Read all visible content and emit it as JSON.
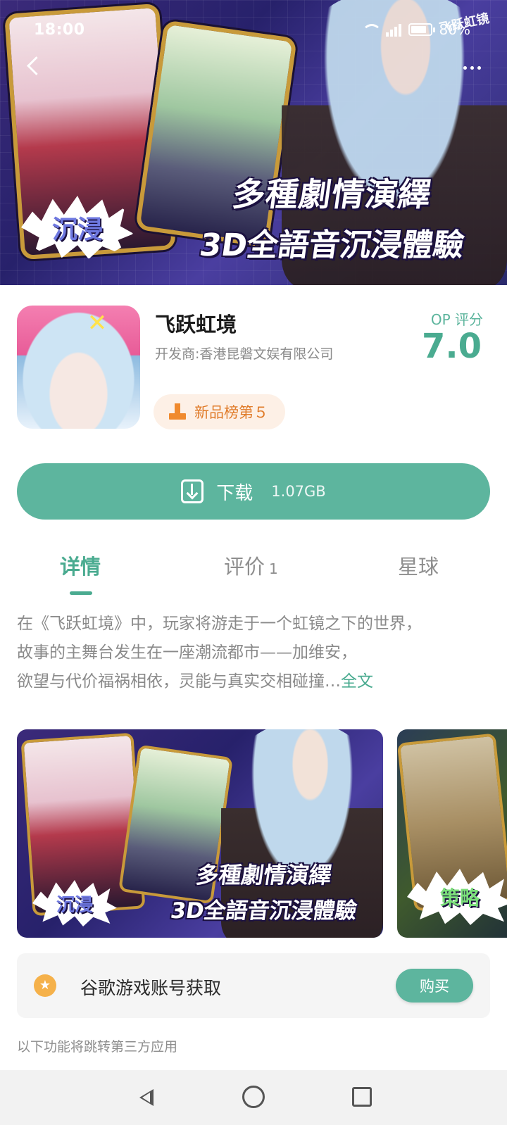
{
  "status_bar": {
    "time": "18:00",
    "network": "4G",
    "battery_percent": "80%",
    "battery_level": 0.8
  },
  "hero": {
    "slogan_line1": "多種劇情演繹",
    "slogan_line2": "3D全語音沉浸體驗",
    "burst_text": "沉浸",
    "logo_text": "飞跃虹镜"
  },
  "app": {
    "name": "飞跃虹境",
    "developer": "开发商:香港昆磐文娱有限公司",
    "rank_badge": "新品榜第５",
    "score_label": "OP 评分",
    "score_value": "7.0"
  },
  "download": {
    "label": "下载",
    "size": "1.07GB"
  },
  "tabs": [
    {
      "label": "详情",
      "active": true
    },
    {
      "label": "评价",
      "count": "1",
      "active": false
    },
    {
      "label": "星球",
      "active": false
    }
  ],
  "description": {
    "line1": "在《飞跃虹境》中，玩家将游走于一个虹镜之下的世界，",
    "line2": "故事的主舞台发生在一座潮流都市——加维安，",
    "line3": "欲望与代价福祸相依，灵能与真实交相碰撞…",
    "more_link": "全文"
  },
  "screenshots": [
    {
      "slogan_line1": "多種劇情演繹",
      "slogan_line2": "3D全語音沉浸體驗",
      "burst_text": "沉浸"
    },
    {
      "burst_text": "策略"
    }
  ],
  "service": {
    "label": "谷歌游戏账号获取",
    "button": "购买"
  },
  "footer_note": "以下功能将跳转第三方应用",
  "icons": {
    "back": "chevron-left-icon",
    "more": "more-dots-icon",
    "rank": "podium-icon",
    "download": "download-icon",
    "service": "star-icon",
    "nav_back": "triangle-back-icon",
    "nav_home": "circle-home-icon",
    "nav_recents": "square-recents-icon"
  },
  "colors": {
    "accent": "#5db59e",
    "accent_text": "#4aab90",
    "rank_bg": "#fdf0e6",
    "rank_text": "#e07b29"
  }
}
